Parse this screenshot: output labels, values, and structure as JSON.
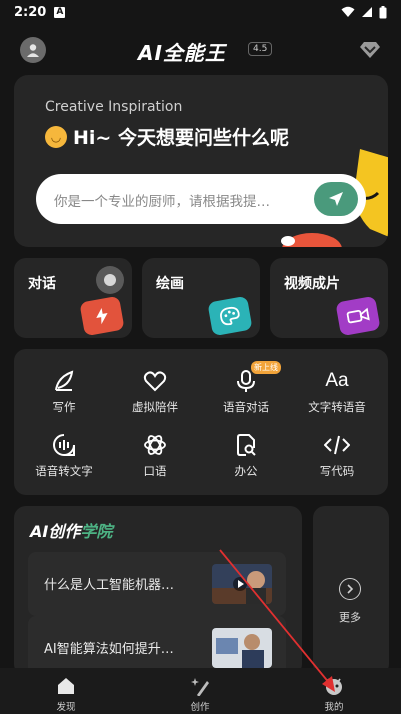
{
  "status_bar": {
    "time": "2:20",
    "notif_badge": "A"
  },
  "header": {
    "brand": "AI全能王",
    "version": "4.5"
  },
  "hero": {
    "subtitle": "Creative Inspiration",
    "greeting": "Hi~ 今天想要问些什么呢",
    "prompt_placeholder": "你是一个专业的厨师，请根据我提…"
  },
  "features": [
    {
      "label": "对话",
      "icon": "lightning-icon",
      "color": "#e2533c"
    },
    {
      "label": "绘画",
      "icon": "palette-icon",
      "color": "#2bb3b7"
    },
    {
      "label": "视频成片",
      "icon": "video-camera-icon",
      "color": "#a23cc6"
    }
  ],
  "tools": {
    "new_badge": "新上线",
    "items": [
      {
        "label": "写作",
        "icon": "quill-icon"
      },
      {
        "label": "虚拟陪伴",
        "icon": "heart-icon"
      },
      {
        "label": "语音对话",
        "icon": "microphone-icon"
      },
      {
        "label": "文字转语音",
        "icon": "text-aa-icon"
      },
      {
        "label": "语音转文字",
        "icon": "voice-wave-icon"
      },
      {
        "label": "口语",
        "icon": "atom-icon"
      },
      {
        "label": "办公",
        "icon": "doc-search-icon"
      },
      {
        "label": "写代码",
        "icon": "code-icon"
      }
    ]
  },
  "academy": {
    "title_a": "AI创作",
    "title_b": "学院",
    "articles": [
      {
        "title": "什么是人工智能机器…"
      },
      {
        "title": "AI智能算法如何提升…"
      }
    ],
    "more_label": "更多"
  },
  "bottom_nav": [
    {
      "label": "发现",
      "icon": "home-icon"
    },
    {
      "label": "创作",
      "icon": "sparkle-icon"
    },
    {
      "label": "我的",
      "icon": "robot-icon"
    }
  ]
}
